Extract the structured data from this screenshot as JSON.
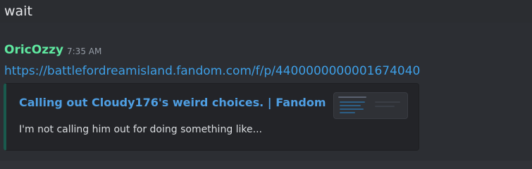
{
  "previous_message": {
    "text": "wait"
  },
  "message": {
    "author": "OricOzzy",
    "author_color": "#5fe8a0",
    "timestamp": "7:35 AM",
    "link": "https://battlefordreamisland.fandom.com/f/p/4400000000001674040",
    "link_color": "#3e9fe6"
  },
  "embed": {
    "title": "Calling out Cloudy176's weird choices. | Fandom",
    "description": "I'm not calling him out for doing something like...",
    "accent_color": "#1a5a4d",
    "thumbnail_icon": "thumbnail-image"
  }
}
